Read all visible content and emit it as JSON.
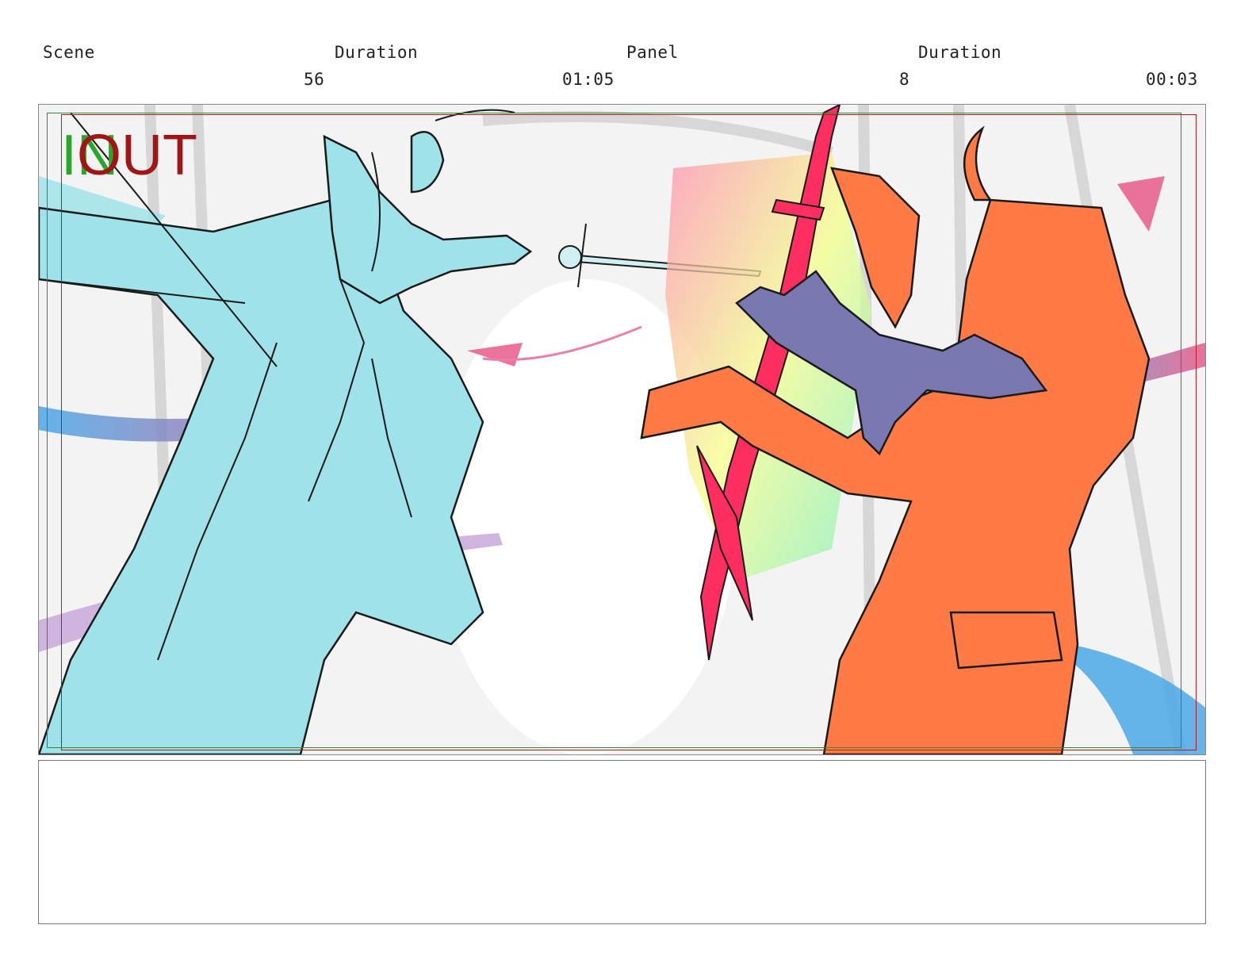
{
  "header": {
    "scene_label": "Scene",
    "scene_duration_label": "Duration",
    "panel_label": "Panel",
    "panel_duration_label": "Duration",
    "scene_value": "56",
    "scene_duration_value": "01:05",
    "panel_value": "8",
    "panel_duration_value": "00:03"
  },
  "frame": {
    "in_label": "IN",
    "out_label": "OUT"
  },
  "notes": {
    "text": ""
  },
  "colors": {
    "cyan_character": "#9fe2ea",
    "orange_character": "#ff7a45",
    "cat": "#7a78b0",
    "weapon_red": "#ff2e60",
    "guide_green": "#2e8b2e",
    "guide_red": "#b01e1e"
  }
}
